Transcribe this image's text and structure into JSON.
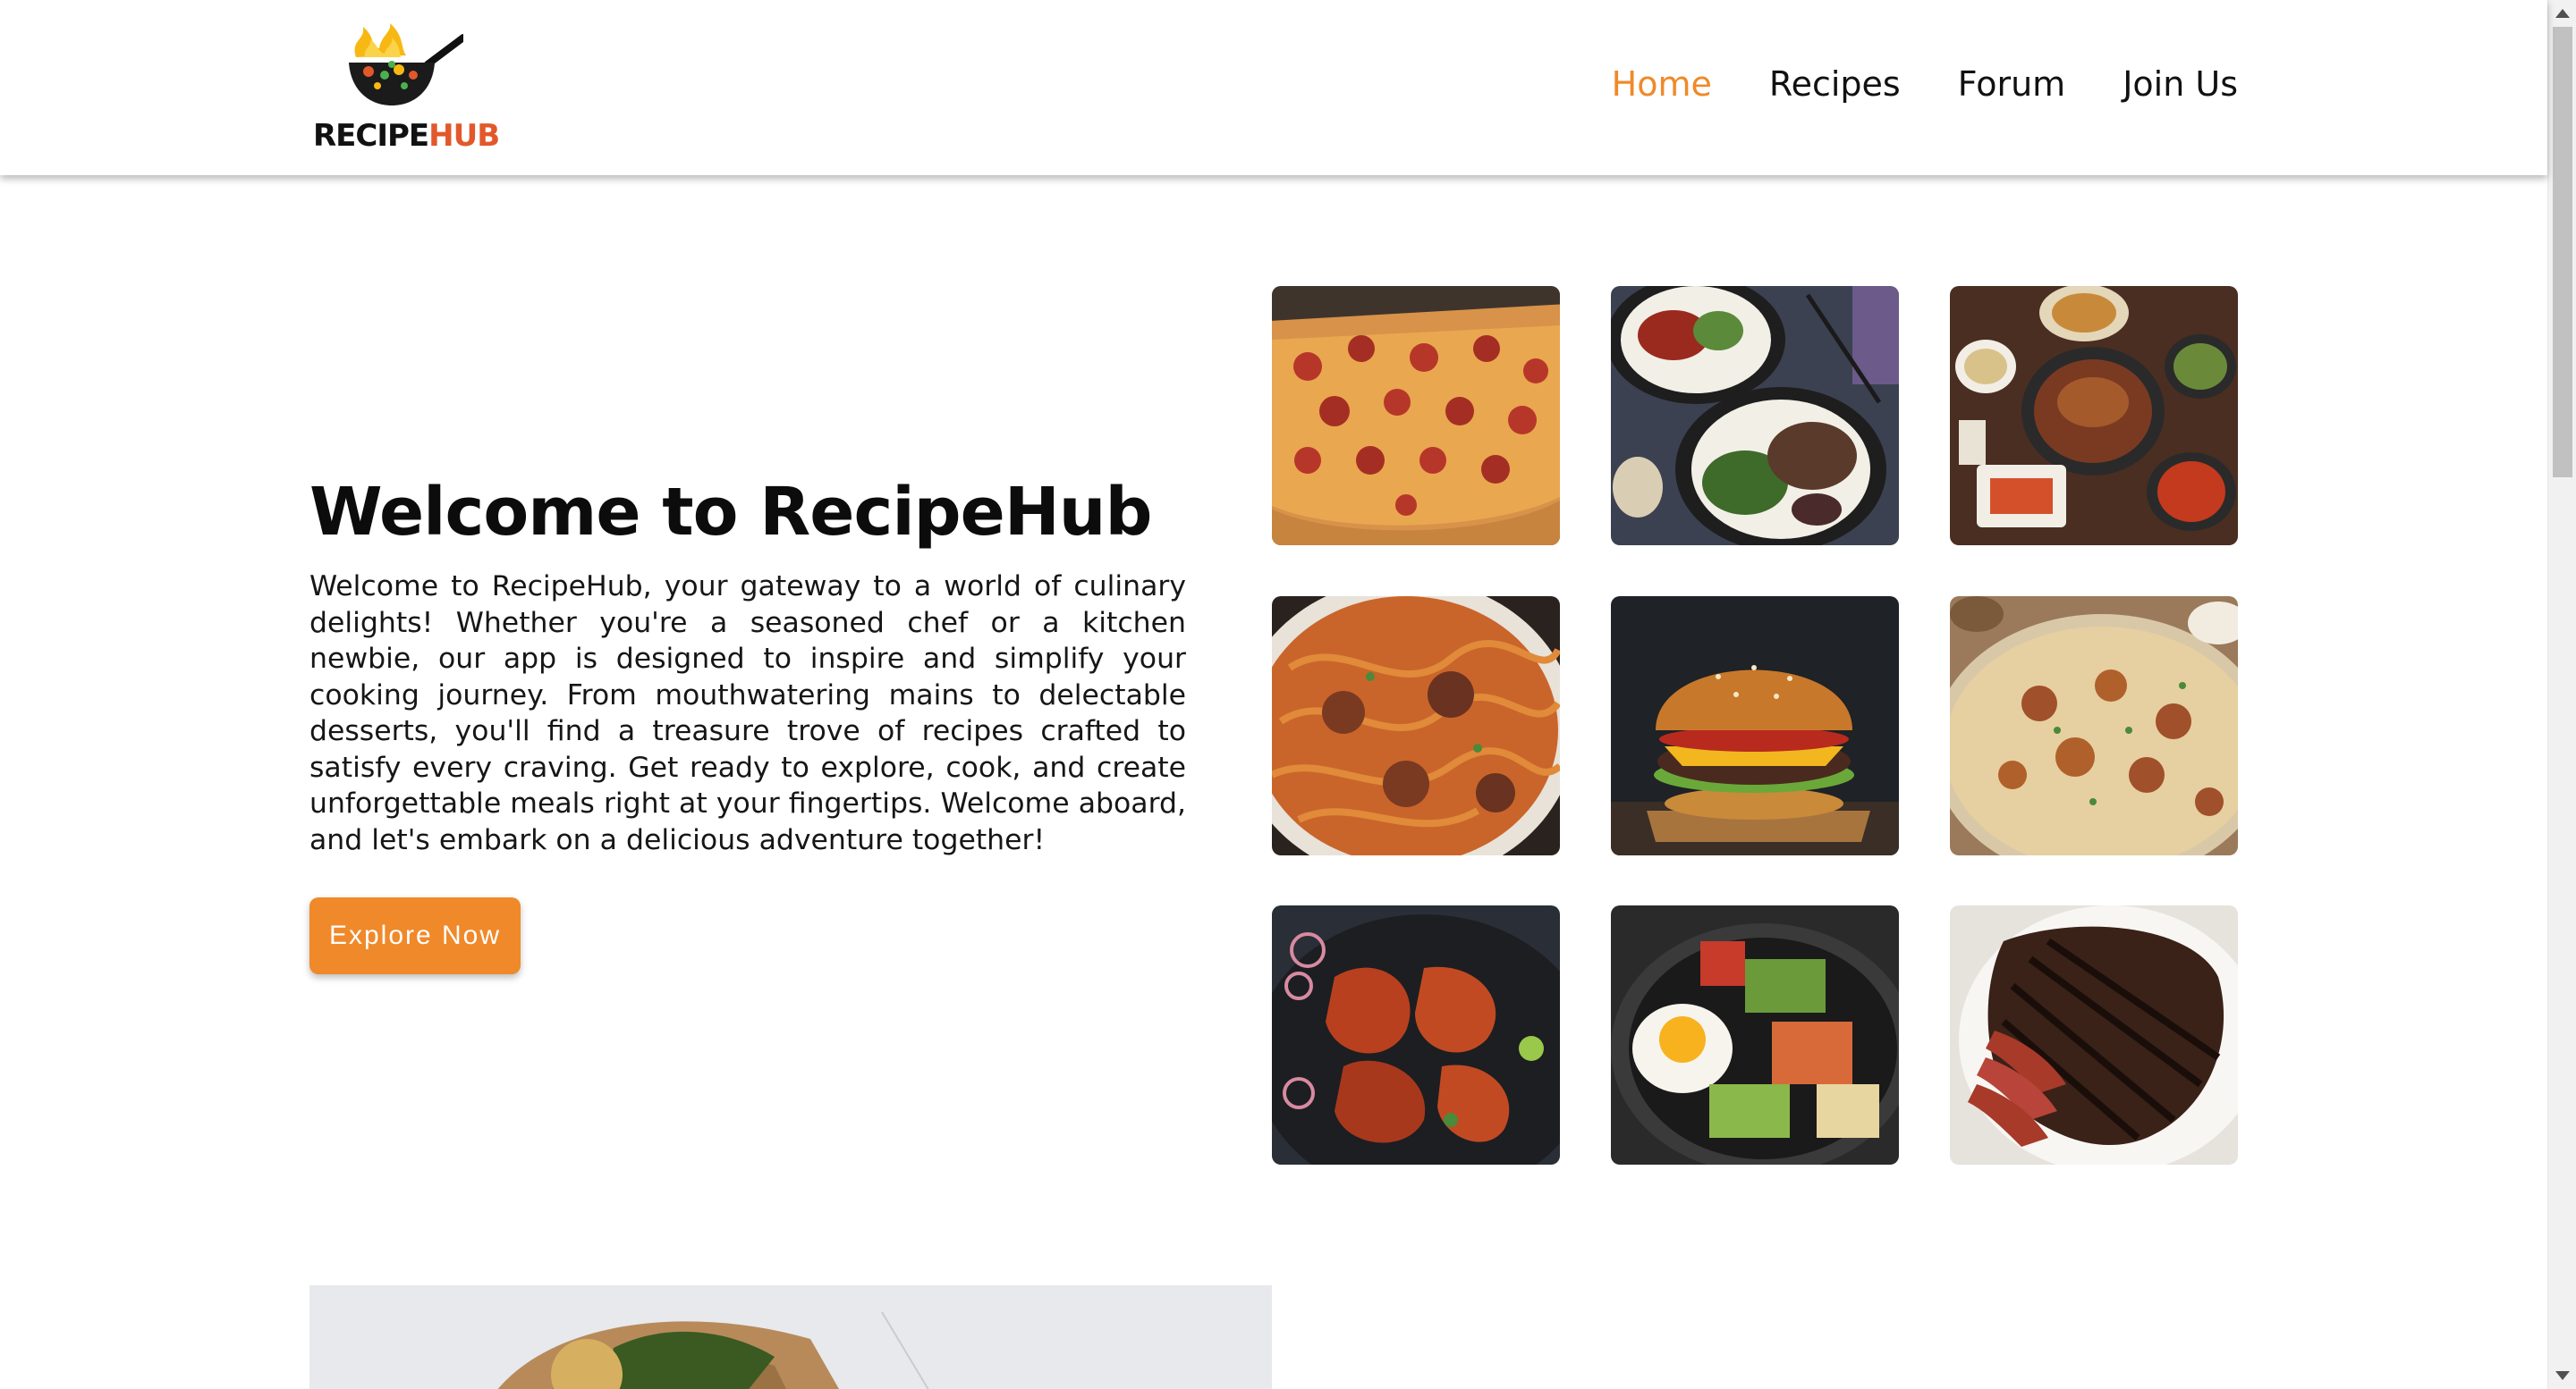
{
  "header": {
    "logo": {
      "word1": "RECIPE",
      "word2": "HUB"
    },
    "nav": [
      {
        "label": "Home",
        "active": true
      },
      {
        "label": "Recipes",
        "active": false
      },
      {
        "label": "Forum",
        "active": false
      },
      {
        "label": "Join Us",
        "active": false
      }
    ]
  },
  "hero": {
    "title": "Welcome to RecipeHub",
    "paragraph": "Welcome to RecipeHub, your gateway to a world of culinary delights! Whether you're a seasoned chef or a kitchen newbie, our app is designed to inspire and simplify your cooking journey. From mouthwatering mains to delectable desserts, you'll find a treasure trove of recipes crafted to satisfy every craving. Get ready to explore, cook, and create unforgettable meals right at your fingertips. Welcome aboard, and let's embark on a delicious adventure together!",
    "button_label": "Explore Now"
  },
  "gallery": {
    "images": [
      "pizza",
      "rice-bowls",
      "korean-table",
      "spaghetti-meatballs",
      "burger",
      "biryani",
      "tandoori-chicken",
      "bibimbap",
      "grilled-steak"
    ]
  },
  "colors": {
    "accent": "#f0892a",
    "logo_hub": "#e2582a",
    "text": "#111111"
  }
}
